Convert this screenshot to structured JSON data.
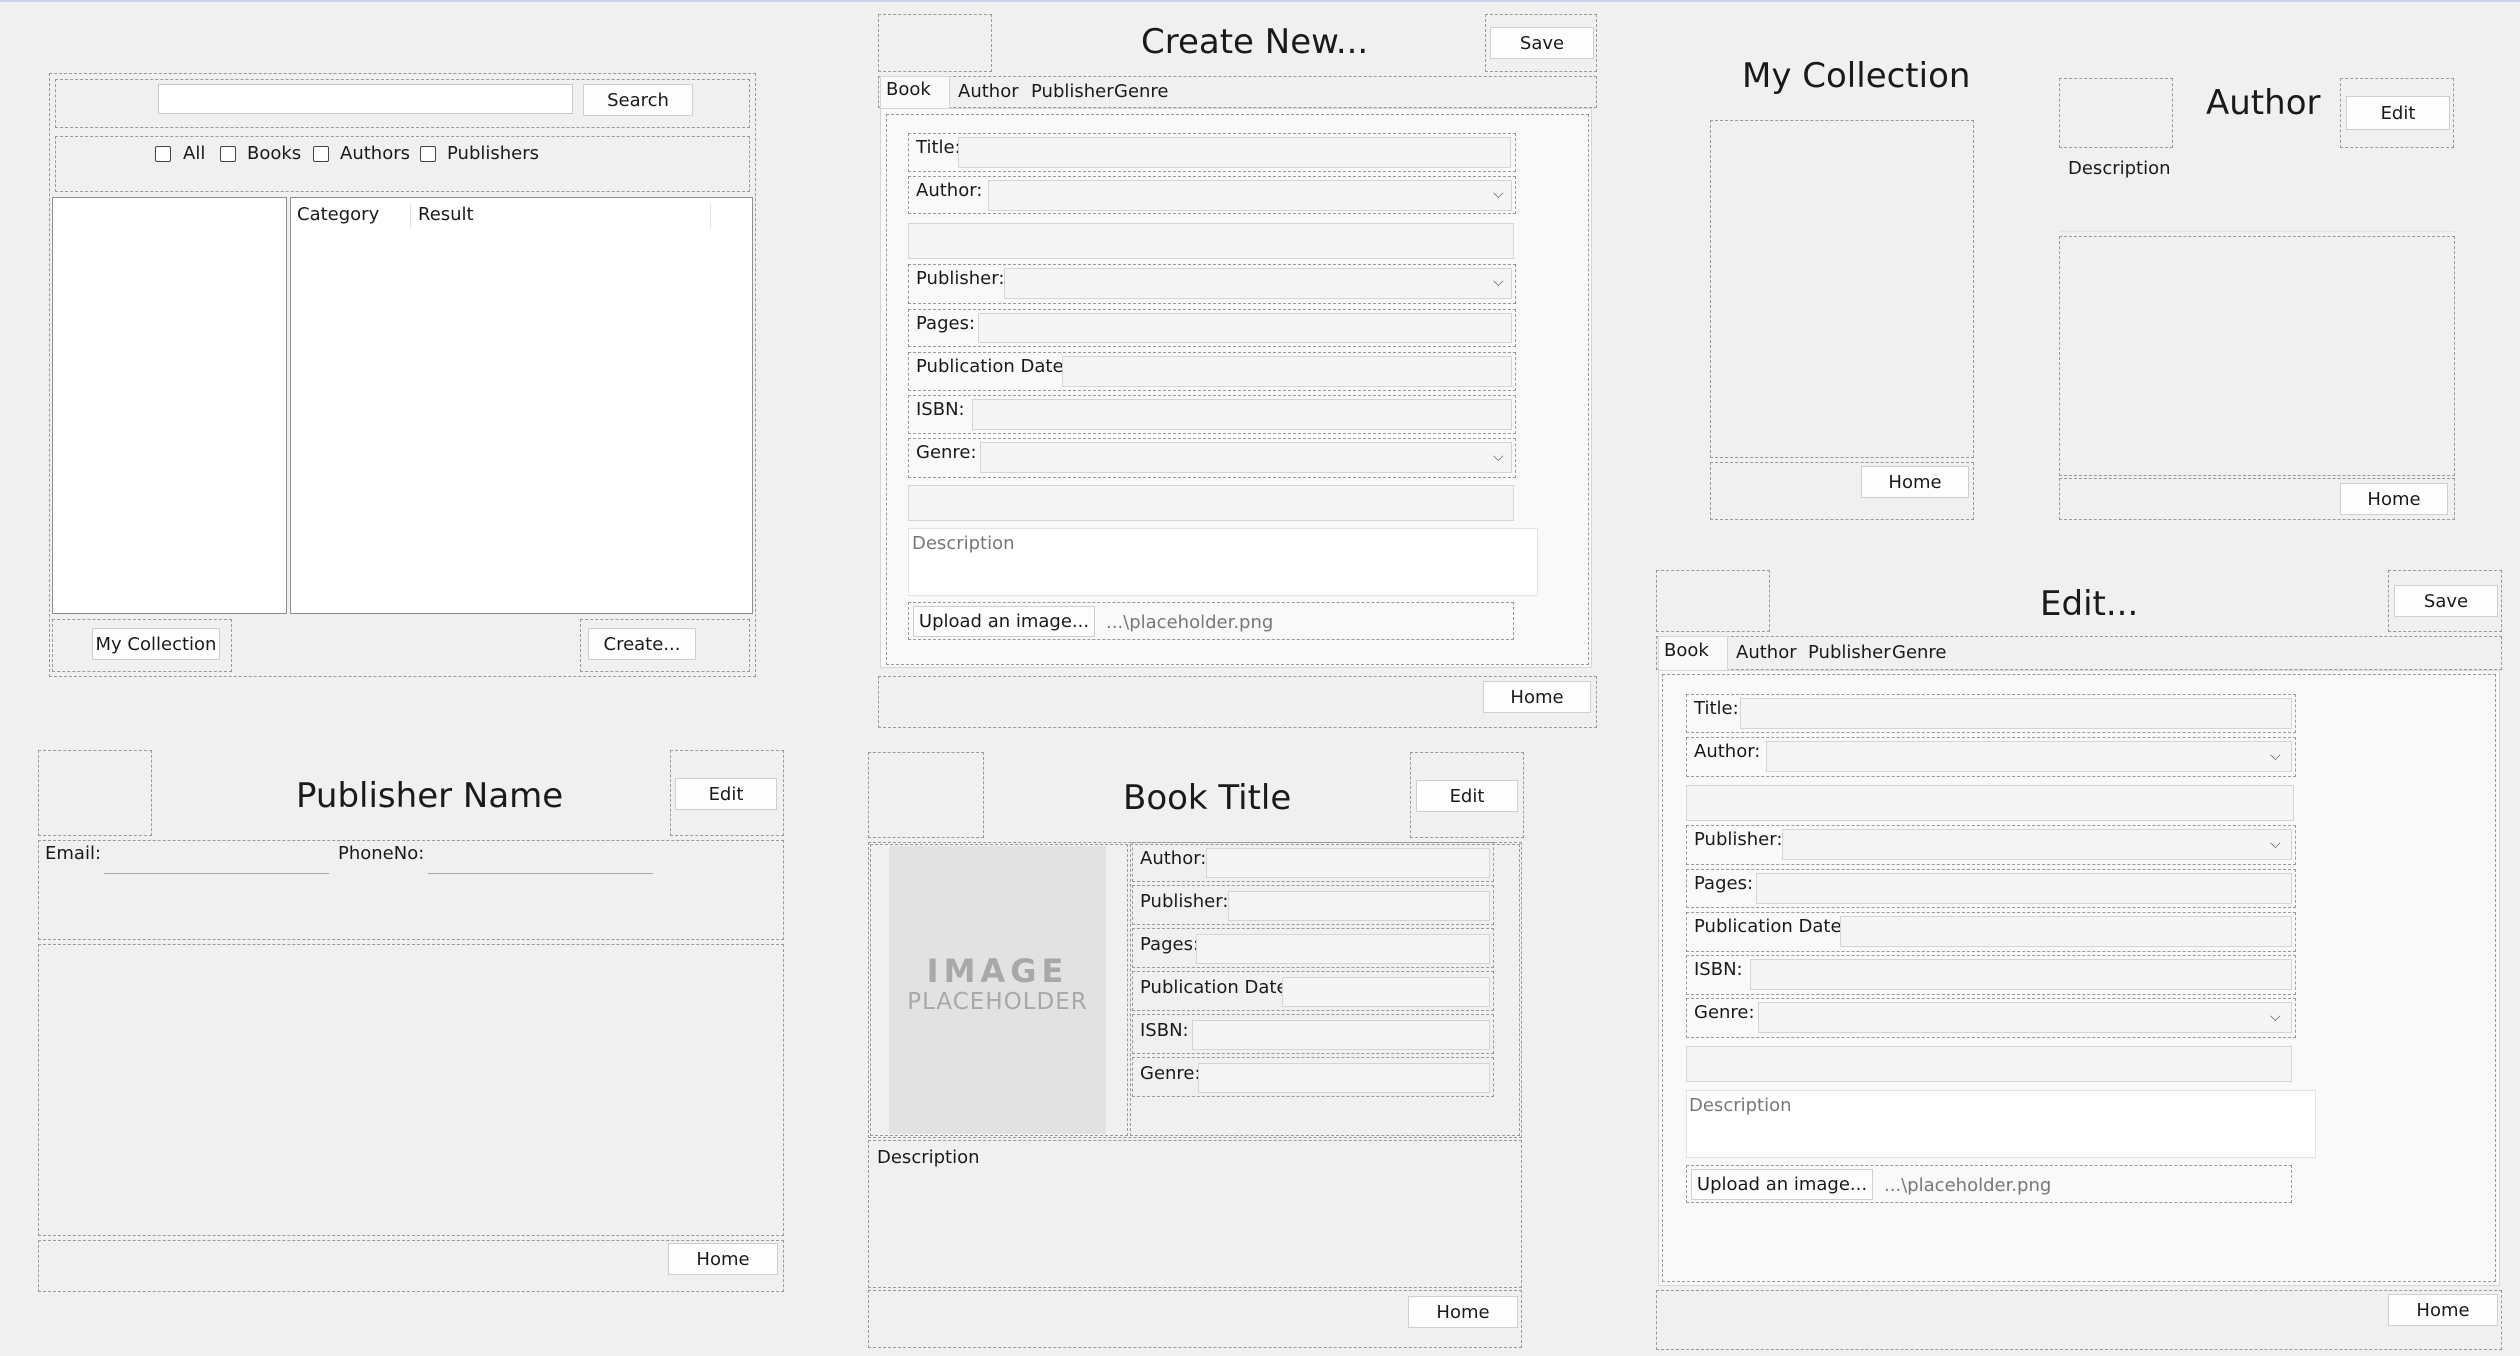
{
  "search_panel": {
    "search_button": "Search",
    "filters": [
      "All",
      "Books",
      "Authors",
      "Publishers"
    ],
    "columns": [
      "Category",
      "Result"
    ],
    "my_collection_button": "My Collection",
    "create_button": "Create..."
  },
  "create_panel": {
    "title": "Create New...",
    "save_button": "Save",
    "tabs": [
      "Book",
      "Author",
      "Publisher",
      "Genre"
    ],
    "labels": {
      "title": "Title:",
      "author": "Author:",
      "publisher": "Publisher:",
      "pages": "Pages:",
      "publication_date": "Publication Date:",
      "isbn": "ISBN:",
      "genre": "Genre:"
    },
    "description_placeholder": "Description",
    "upload_button": "Upload an image...",
    "image_path": "...\\placeholder.png",
    "home_button": "Home"
  },
  "collection_panel": {
    "title": "My Collection",
    "home_button": "Home"
  },
  "author_panel": {
    "title": "Author",
    "edit_button": "Edit",
    "description_label": "Description",
    "home_button": "Home"
  },
  "publisher_panel": {
    "title": "Publisher Name",
    "edit_button": "Edit",
    "email_label": "Email:",
    "phone_label": "PhoneNo:",
    "home_button": "Home"
  },
  "book_panel": {
    "title": "Book Title",
    "edit_button": "Edit",
    "image_placeholder_line1": "IMAGE",
    "image_placeholder_line2": "PLACEHOLDER",
    "labels": {
      "author": "Author:",
      "publisher": "Publisher:",
      "pages": "Pages:",
      "publication_date": "Publication Date:",
      "isbn": "ISBN:",
      "genre": "Genre:"
    },
    "description_label": "Description",
    "home_button": "Home"
  },
  "edit_panel": {
    "title": "Edit...",
    "save_button": "Save",
    "tabs": [
      "Book",
      "Author",
      "Publisher",
      "Genre"
    ],
    "labels": {
      "title": "Title:",
      "author": "Author:",
      "publisher": "Publisher:",
      "pages": "Pages:",
      "publication_date": "Publication Date:",
      "isbn": "ISBN:",
      "genre": "Genre:"
    },
    "description_placeholder": "Description",
    "upload_button": "Upload an image...",
    "image_path": "...\\placeholder.png",
    "home_button": "Home"
  }
}
